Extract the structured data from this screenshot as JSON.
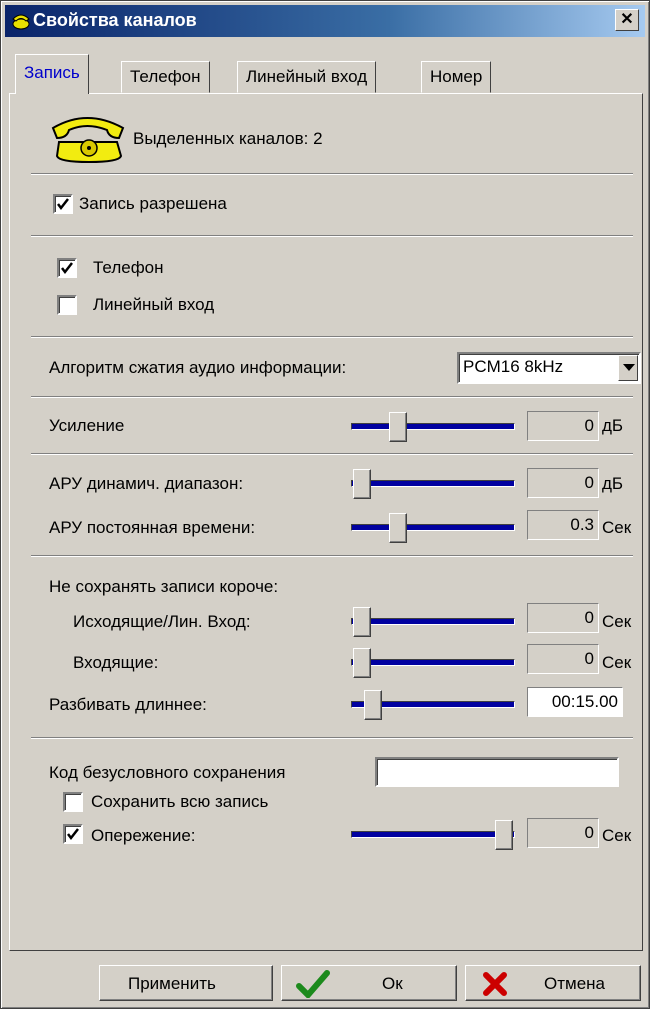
{
  "window": {
    "title": "Свойства каналов",
    "close_glyph": "✕"
  },
  "tabs": [
    {
      "label": "Запись",
      "active": true
    },
    {
      "label": "Телефон",
      "active": false
    },
    {
      "label": "Линейный вход",
      "active": false
    },
    {
      "label": "Номер",
      "active": false
    }
  ],
  "header": {
    "icon": "telephone-icon",
    "channels_label": "Выделенных каналов: 2"
  },
  "recording_enabled": {
    "label": "Запись разрешена",
    "checked": true
  },
  "sources": {
    "phone": {
      "label": "Телефон",
      "checked": true
    },
    "line_in": {
      "label": "Линейный вход",
      "checked": false
    }
  },
  "compression": {
    "label": "Алгоритм сжатия аудио информации:",
    "value": "PCM16 8kHz"
  },
  "gain": {
    "label": "Усиление",
    "value": "0",
    "unit": "дБ",
    "level": 0.25
  },
  "agc_range": {
    "label": "АРУ динамич. диапазон:",
    "value": "0",
    "unit": "дБ",
    "level": 0.0
  },
  "agc_time": {
    "label": "АРУ постоянная времени:",
    "value": "0.3",
    "unit": "Сек",
    "level": 0.25
  },
  "min_length": {
    "label": "Не сохранять записи короче:",
    "outgoing": {
      "label": "Исходящие/Лин. Вход:",
      "value": "0",
      "unit": "Сек",
      "level": 0.0
    },
    "incoming": {
      "label": "Входящие:",
      "value": "0",
      "unit": "Сек",
      "level": 0.0
    }
  },
  "split": {
    "label": "Разбивать длиннее:",
    "value": "00:15.00",
    "level": 0.08
  },
  "unconditional_code": {
    "label": "Код безусловного сохранения",
    "value": ""
  },
  "save_all": {
    "label": "Сохранить всю запись",
    "checked": false
  },
  "pre_record": {
    "label": "Опережение:",
    "checked": true,
    "value": "0",
    "unit": "Сек",
    "level": 1.0
  },
  "buttons": {
    "apply": "Применить",
    "ok": "Ок",
    "cancel": "Отмена"
  },
  "colors": {
    "slider_track": "#0000a0",
    "title_start": "#0a246a",
    "title_end": "#a6caf0",
    "ok_check": "#1c8a1c",
    "cancel_x": "#cc0000"
  }
}
